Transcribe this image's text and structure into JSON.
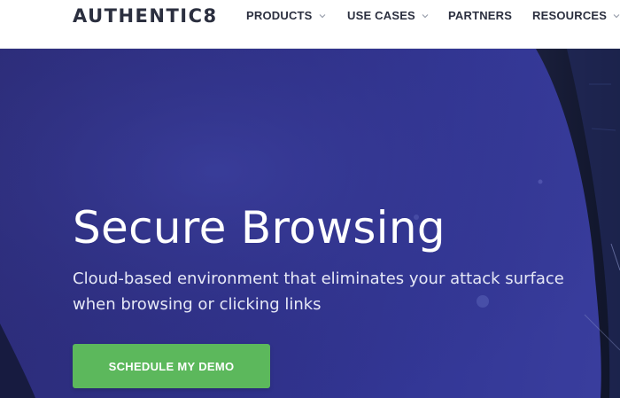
{
  "header": {
    "logo_text": "AUTHENTIC8",
    "nav": [
      {
        "label": "PRODUCTS",
        "has_dropdown": true,
        "icon": "chevron-down-icon"
      },
      {
        "label": "USE CASES",
        "has_dropdown": true,
        "icon": "chevron-down-icon"
      },
      {
        "label": "PARTNERS",
        "has_dropdown": false
      },
      {
        "label": "RESOURCES",
        "has_dropdown": true,
        "icon": "chevron-down-icon"
      }
    ]
  },
  "hero": {
    "title": "Secure Browsing",
    "subtitle": "Cloud-based environment that eliminates your attack surface when browsing or clicking links",
    "cta_label": "SCHEDULE MY DEMO"
  },
  "colors": {
    "hero_background": "#2f318a",
    "cta_background": "#5cb85c",
    "header_text": "#2b2f3f",
    "hero_text": "#ffffff"
  }
}
